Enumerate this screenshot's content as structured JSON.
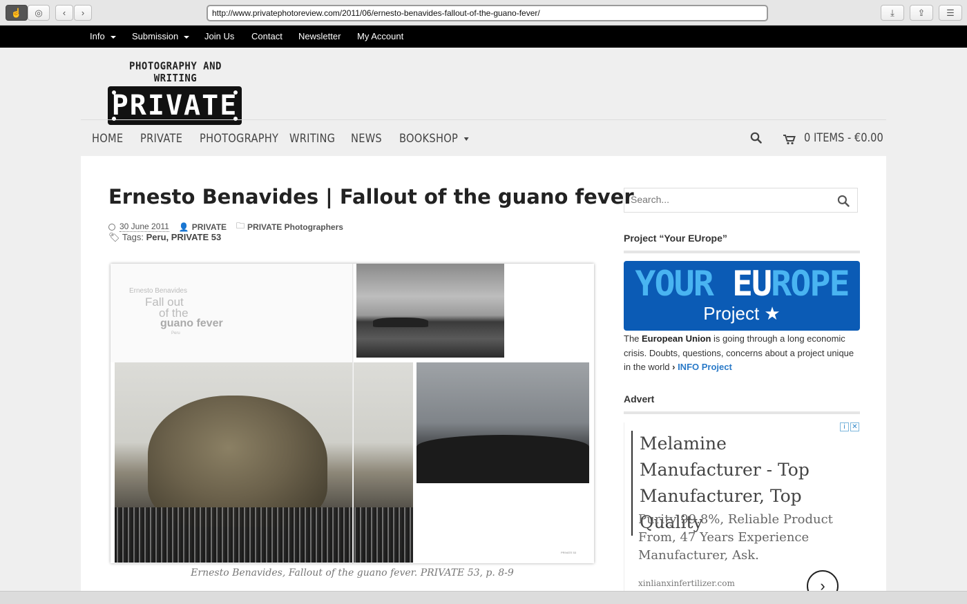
{
  "browser": {
    "url": "http://www.privatephotoreview.com/2011/06/ernesto-benavides-fallout-of-the-guano-fever/"
  },
  "topnav": {
    "items": [
      {
        "label": "Info",
        "dropdown": true
      },
      {
        "label": "Submission",
        "dropdown": true
      },
      {
        "label": "Join Us"
      },
      {
        "label": "Contact"
      },
      {
        "label": "Newsletter"
      },
      {
        "label": "My Account"
      }
    ]
  },
  "logo": {
    "tagline": "PHOTOGRAPHY AND WRITING",
    "word": "PRIVATE"
  },
  "mainnav": {
    "items": [
      "HOME",
      "PRIVATE",
      "PHOTOGRAPHY",
      "WRITING",
      "NEWS",
      "BOOKSHOP"
    ],
    "cart": "0 ITEMS - €0.00"
  },
  "article": {
    "title": "Ernesto Benavides | Fallout of the guano fever",
    "date": "30 June 2011",
    "author": "PRIVATE",
    "category": "PRIVATE Photographers",
    "tags_label": "Tags:",
    "tags": "Peru, PRIVATE 53",
    "spread": {
      "author": "Ernesto Benavides",
      "title_line1": "Fall out",
      "title_line2": "of the",
      "title_line3": "guano fever",
      "subtitle": "Peru",
      "page_footer": "PRIVATE 53"
    },
    "caption": "Ernesto Benavides, Fallout of the guano fever. PRIVATE 53, p. 8-9"
  },
  "sidebar": {
    "search_placeholder": "Search...",
    "project_title": "Project “Your EUrope”",
    "banner": {
      "your": "YOUR",
      "eu": "EU",
      "rope": "ROPE",
      "project": "Project ★"
    },
    "text_pre": "The ",
    "text_bold": "European Union",
    "text_post": " is going through a long economic crisis. Doubts, questions, concerns about a project unique in the world ",
    "link": "INFO Project",
    "advert_title": "Advert",
    "ad": {
      "headline": "Melamine Manufacturer - Top Manufacturer, Top Quality",
      "body": "Purity 99.8%, Reliable Product From, 47 Years Experience Manufacturer, Ask.",
      "url": "xinlianxinfertilizer.com"
    }
  },
  "colors": {
    "accent_link": "#2a7ac8",
    "banner_blue": "#0b5bb5",
    "banner_light": "#49b4f1"
  }
}
